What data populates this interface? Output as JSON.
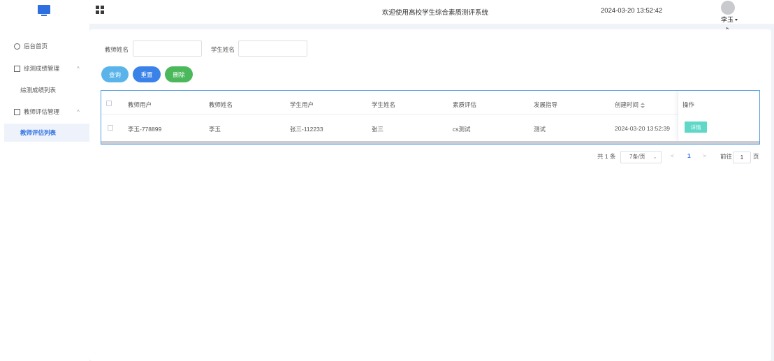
{
  "header": {
    "title": "欢迎使用高校学生综合素质测评系统",
    "datetime": "2024-03-20 13:52:42",
    "user_name": "李玉"
  },
  "sidebar": {
    "items": [
      {
        "label": "后台首页",
        "icon": "clock-icon"
      },
      {
        "label": "综测成绩管理",
        "icon": "document-icon",
        "expanded": true,
        "children": [
          {
            "label": "综测成绩列表"
          }
        ]
      },
      {
        "label": "教师评估管理",
        "icon": "checkbox-icon",
        "expanded": true,
        "children": [
          {
            "label": "教师评估列表",
            "active": true
          }
        ]
      }
    ]
  },
  "search": {
    "teacher_name_label": "教师姓名",
    "teacher_name_value": "",
    "student_name_label": "学生姓名",
    "student_name_value": ""
  },
  "actions": {
    "query_label": "查询",
    "reset_label": "重置",
    "delete_label": "删除"
  },
  "colors": {
    "query": "#5ab4ea",
    "reset": "#3b82e8",
    "delete": "#4cb85c",
    "detail": "#5fd8c7",
    "accent": "#2e6fe0"
  },
  "table": {
    "columns": [
      "教师用户",
      "教师姓名",
      "学生用户",
      "学生姓名",
      "素质评估",
      "发展指导",
      "创建时间",
      "操作"
    ],
    "rows": [
      {
        "teacher_user": "李玉-778899",
        "teacher_name": "李玉",
        "student_user": "张三-112233",
        "student_name": "张三",
        "evaluation": "cs测试",
        "guidance": "测试",
        "created": "2024-03-20 13:52:39",
        "action_label": "详情"
      }
    ]
  },
  "pagination": {
    "total_text": "共 1 条",
    "page_size": "7条/页",
    "prev": "<",
    "current_page": "1",
    "next": ">",
    "goto_label": "前往",
    "goto_value": "1",
    "page_suffix": "页"
  }
}
